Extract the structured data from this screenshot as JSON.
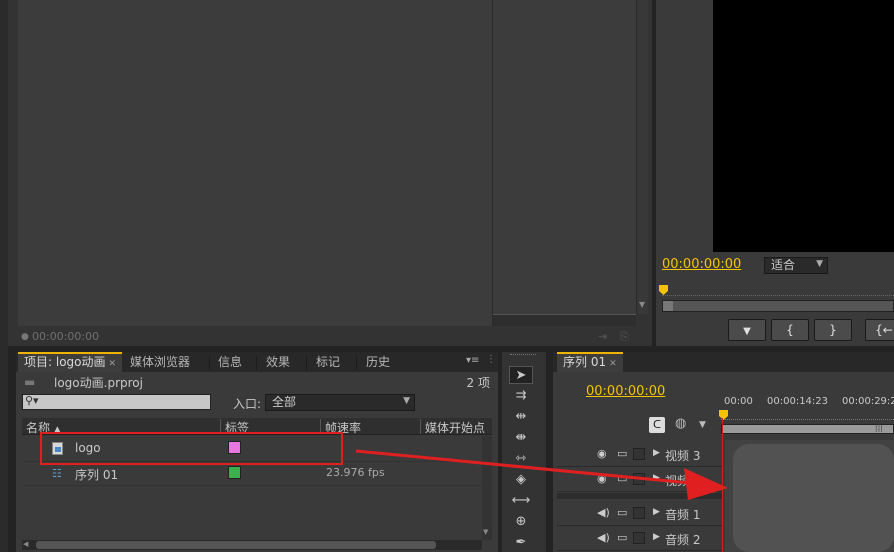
{
  "source_monitor": {
    "timecode": "00:00:00:00"
  },
  "program_monitor": {
    "timecode": "00:00:00:00",
    "zoom_select": "适合"
  },
  "project_panel": {
    "tabs": [
      {
        "label": "项目: logo动画",
        "active": true,
        "closable": true
      },
      {
        "label": "媒体浏览器"
      },
      {
        "label": "信息"
      },
      {
        "label": "效果"
      },
      {
        "label": "标记"
      },
      {
        "label": "历史"
      }
    ],
    "filename": "logo动画.prproj",
    "item_count": "2 项",
    "search_placeholder": "",
    "inpoint_label": "入口:",
    "inpoint_value": "全部",
    "columns": [
      "名称",
      "标签",
      "帧速率",
      "媒体开始点"
    ],
    "rows": [
      {
        "name": "logo",
        "label_color": "#e878e0",
        "fps": "",
        "type": "image"
      },
      {
        "name": "序列 01",
        "label_color": "#3cb04c",
        "fps": "23.976 fps",
        "type": "sequence"
      }
    ]
  },
  "timeline": {
    "tab_label": "序列 01",
    "timecode": "00:00:00:00",
    "ruler_labels": [
      "00:00",
      "00:00:14:23",
      "00:00:29:2"
    ],
    "tracks": [
      {
        "name": "视频 3",
        "kind": "video"
      },
      {
        "name": "视频",
        "kind": "video"
      },
      {
        "name": "音频 1",
        "kind": "audio"
      },
      {
        "name": "音频 2",
        "kind": "audio"
      }
    ]
  },
  "colors": {
    "accent": "#f5c400",
    "highlight_box": "#e02020"
  }
}
